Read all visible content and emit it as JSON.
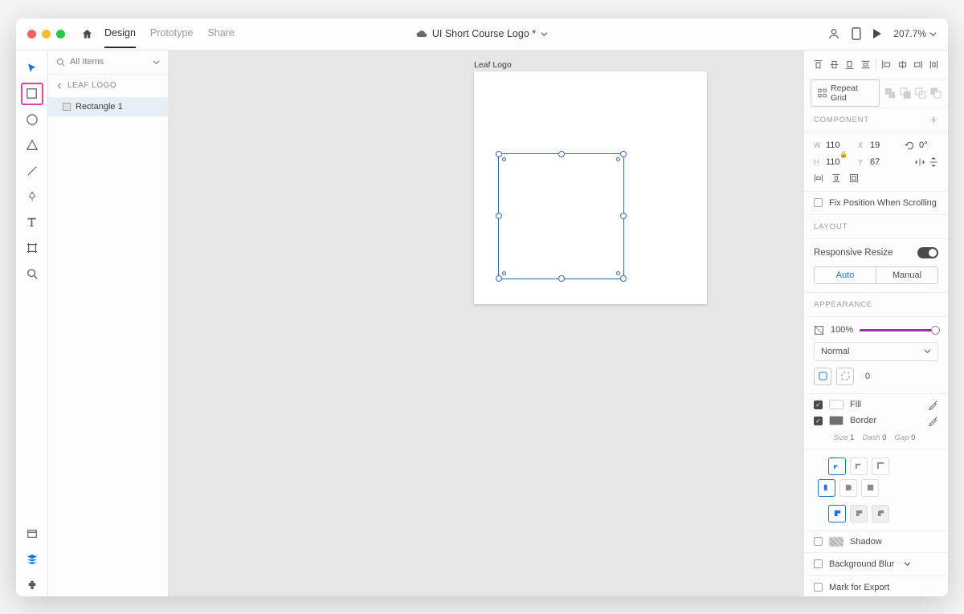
{
  "titlebar": {
    "tabs": {
      "design": "Design",
      "prototype": "Prototype",
      "share": "Share"
    },
    "document": "UI Short Course Logo *",
    "zoom": "207.7%"
  },
  "layersPanel": {
    "search": "All Items",
    "artboard": "LEAF LOGO",
    "items": [
      {
        "name": "Rectangle 1"
      }
    ]
  },
  "canvas": {
    "artboardLabel": "Leaf Logo"
  },
  "inspector": {
    "repeatGrid": "Repeat Grid",
    "componentHeader": "COMPONENT",
    "transform": {
      "wLabel": "W",
      "w": "110",
      "hLabel": "H",
      "h": "110",
      "xLabel": "X",
      "x": "19",
      "yLabel": "Y",
      "y": "67",
      "rotLabel": "0°"
    },
    "fixPosition": "Fix Position When Scrolling",
    "layoutHeader": "LAYOUT",
    "responsiveResize": "Responsive Resize",
    "auto": "Auto",
    "manual": "Manual",
    "appearanceHeader": "APPEARANCE",
    "opacity": "100%",
    "blendMode": "Normal",
    "cornerRadius": "0",
    "fillLabel": "Fill",
    "borderLabel": "Border",
    "strokeSize": "Size",
    "strokeSizeVal": "1",
    "strokeDash": "Dash",
    "strokeDashVal": "0",
    "strokeGap": "Gap",
    "strokeGapVal": "0",
    "shadow": "Shadow",
    "bgBlur": "Background Blur",
    "markExport": "Mark for Export"
  }
}
